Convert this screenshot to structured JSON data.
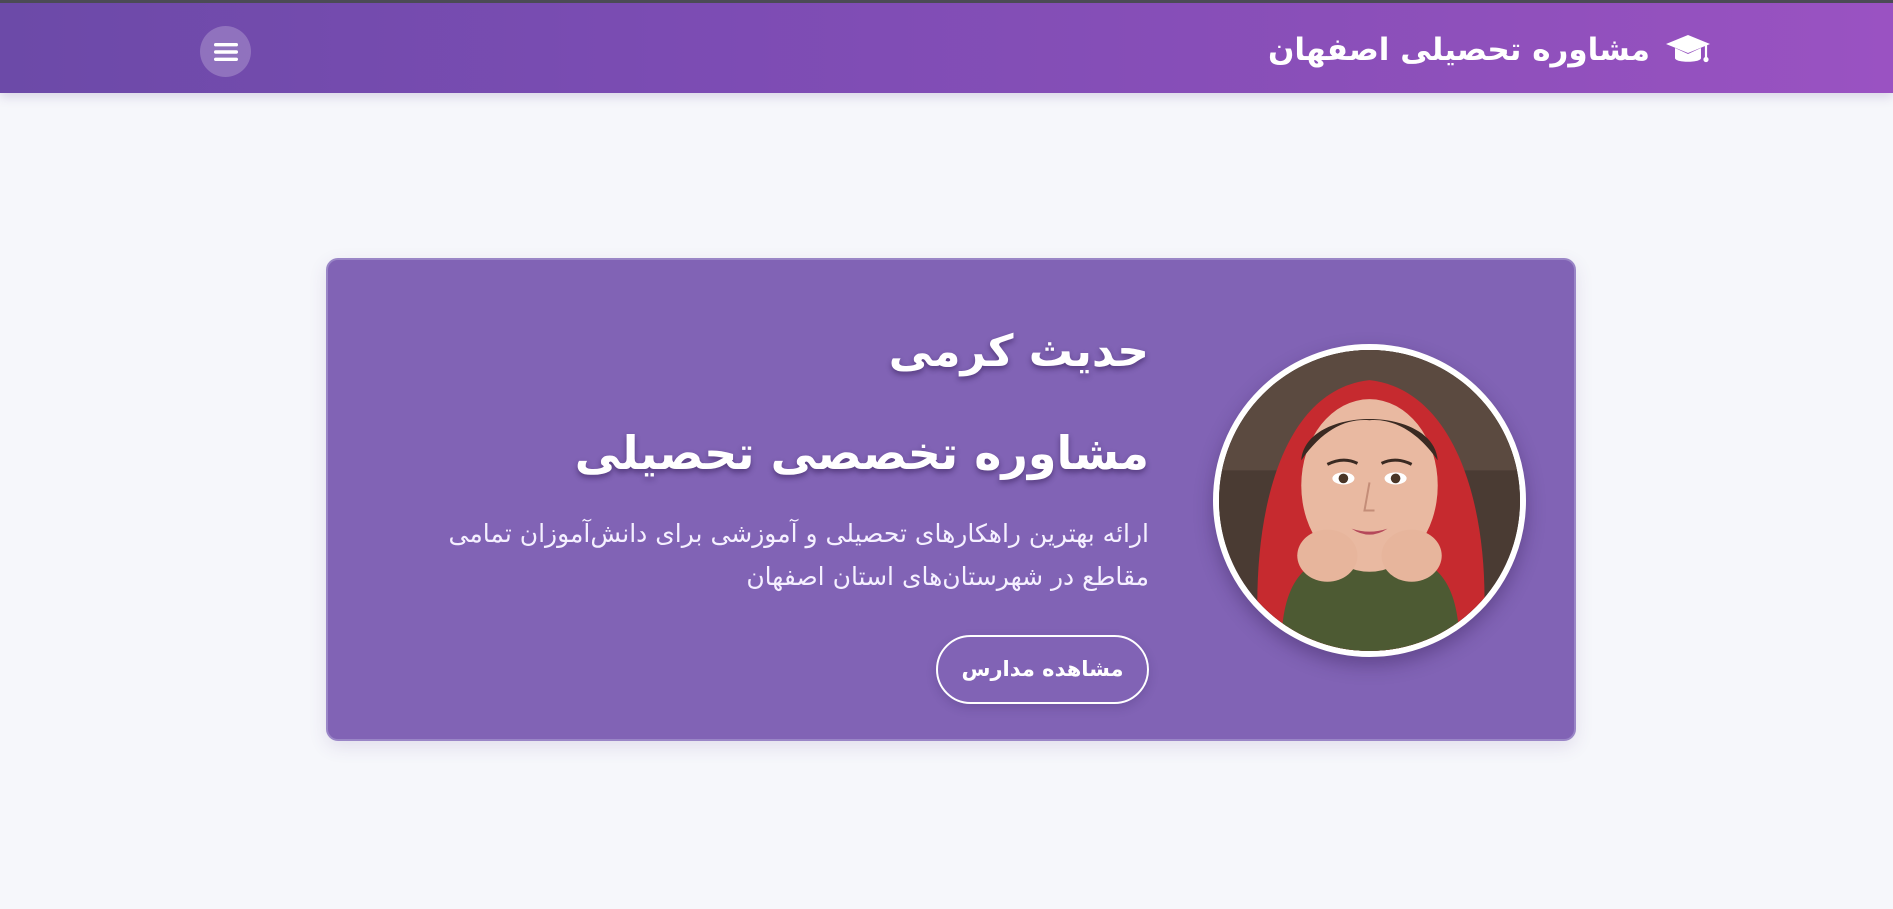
{
  "header": {
    "brand_title": "مشاوره تحصیلی اصفهان",
    "brand_icon": "graduation-cap-icon",
    "menu_icon": "hamburger-menu-icon"
  },
  "hero": {
    "name": "حدیث کرمی",
    "title": "مشاوره تخصصی تحصیلی",
    "description": "ارائه بهترین راهکارهای تحصیلی و آموزشی برای دانش‌آموزان تمامی مقاطع در شهرستان‌های استان اصفهان",
    "cta_label": "مشاهده مدارس"
  },
  "colors": {
    "header_gradient_start": "#6c4aa8",
    "header_gradient_end": "#9a52c2",
    "card_background": "#8163b5",
    "page_background": "#f6f7fb",
    "text": "#ffffff"
  }
}
